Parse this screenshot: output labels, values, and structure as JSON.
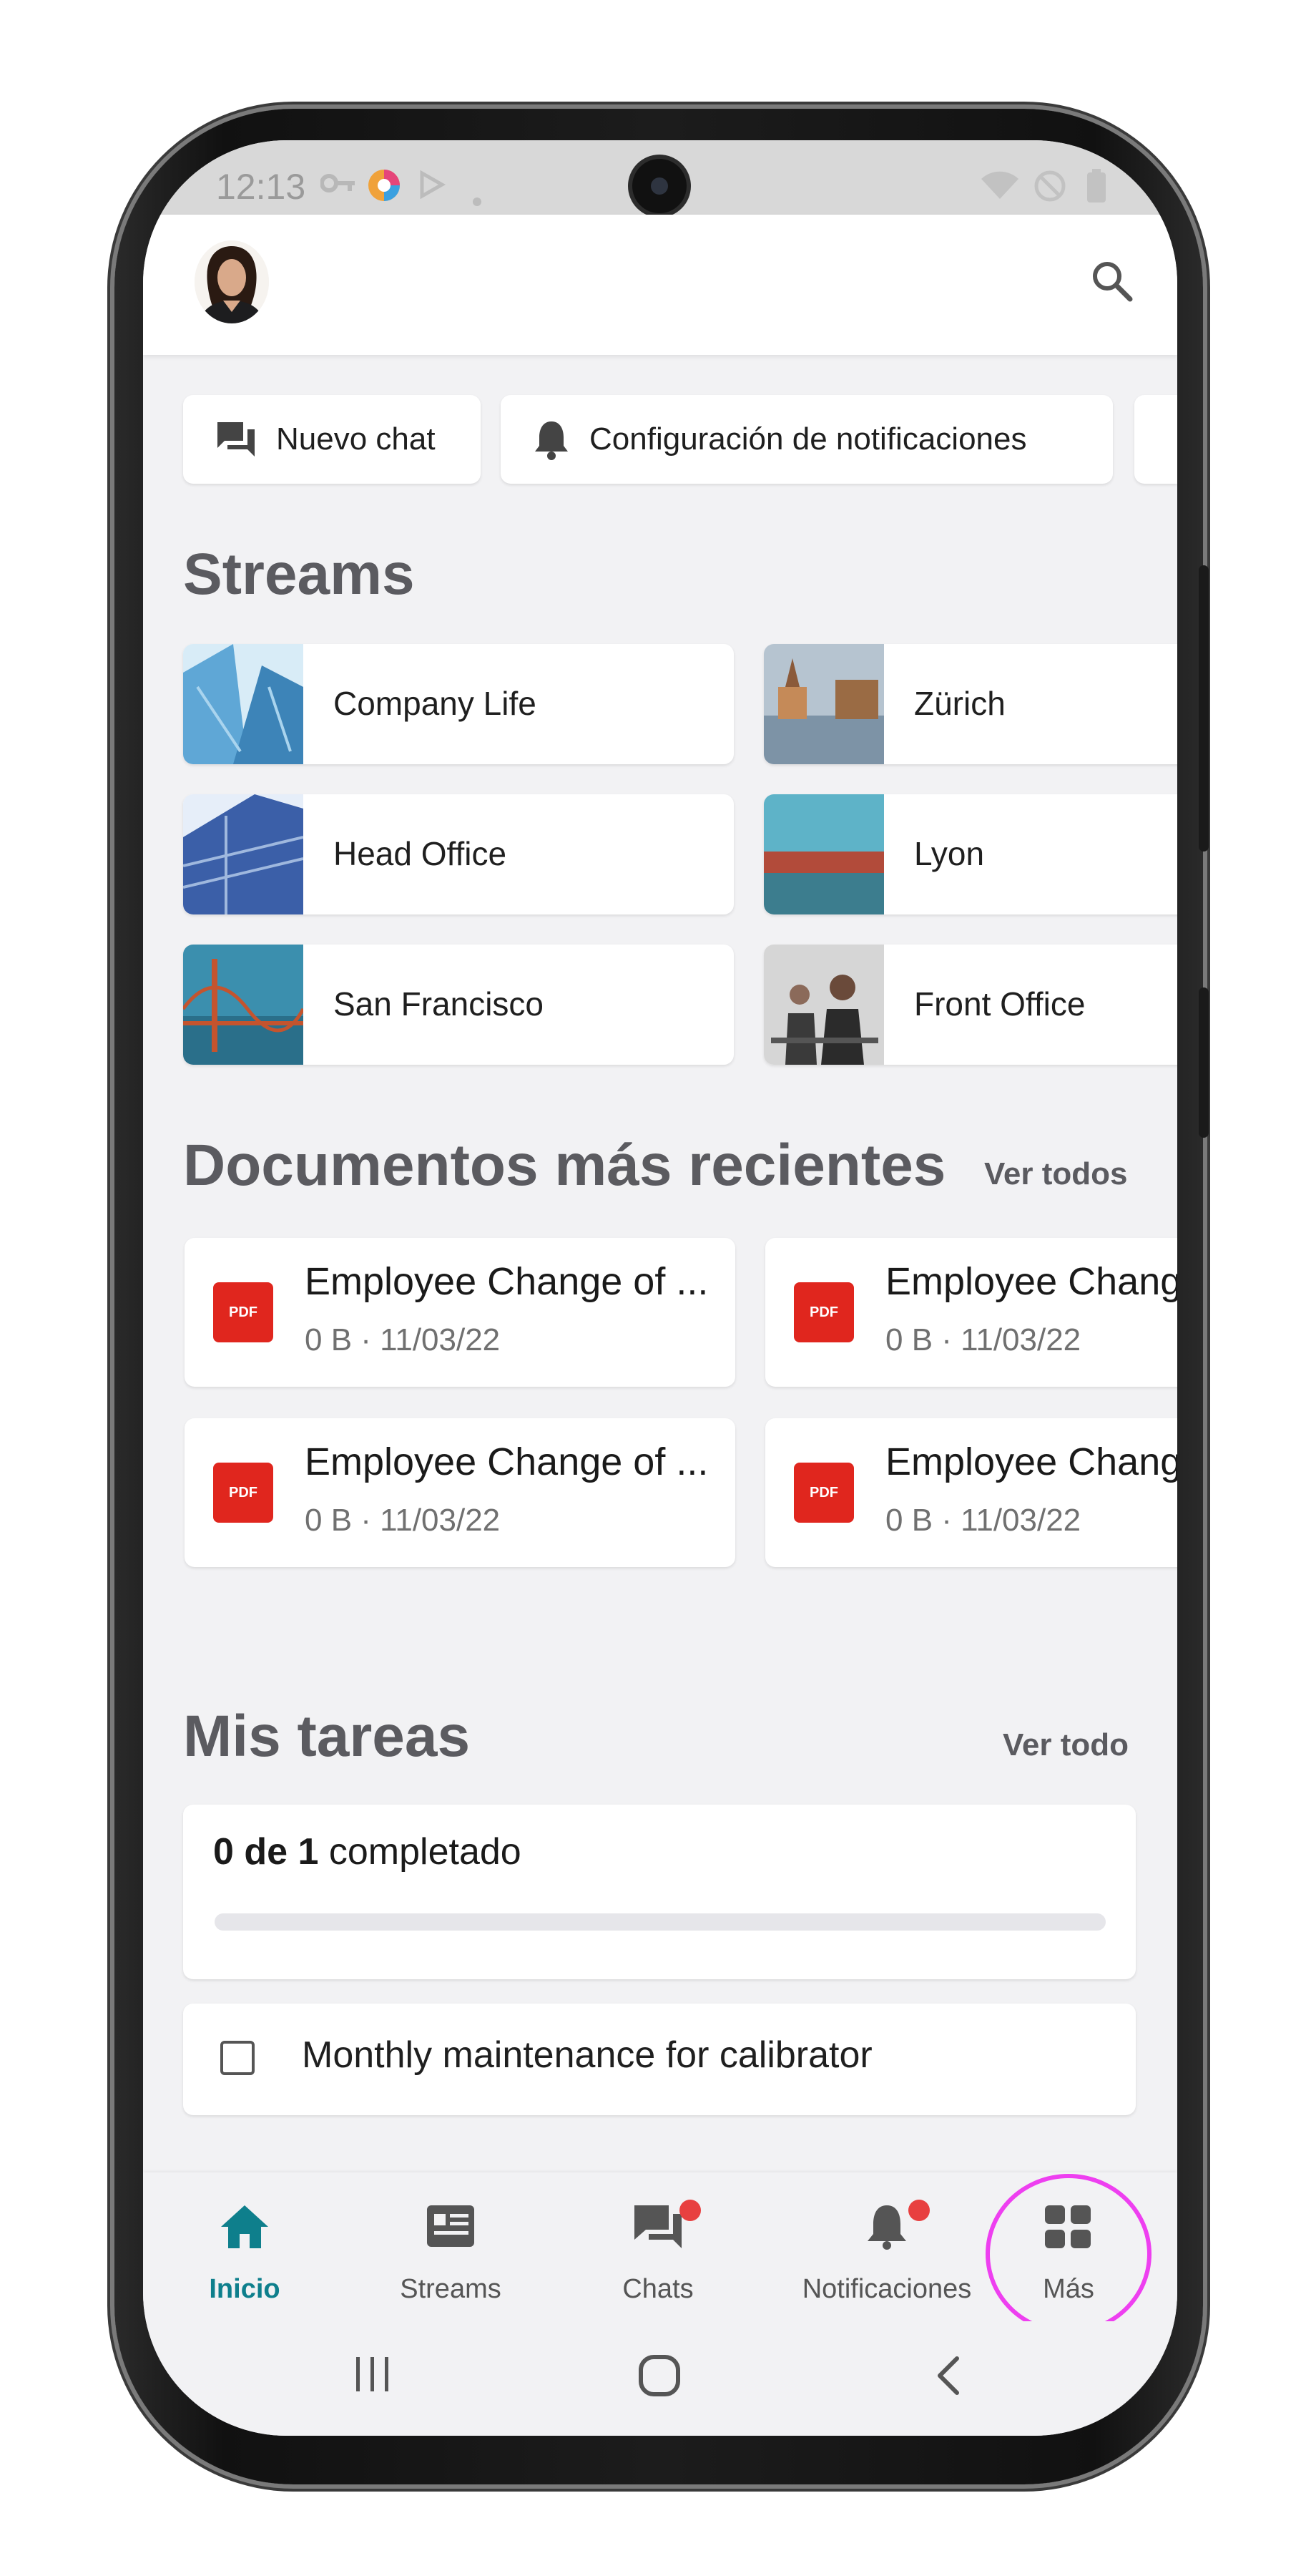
{
  "status_bar": {
    "time": "12:13"
  },
  "quick_actions": [
    {
      "label": "Nuevo chat",
      "icon": "chat-icon"
    },
    {
      "label": "Configuración de notificaciones",
      "icon": "bell-icon"
    }
  ],
  "streams": {
    "title": "Streams",
    "items": [
      {
        "label": "Company Life",
        "thumb_colors": [
          "#5fa7d6",
          "#d8ecf7"
        ]
      },
      {
        "label": "Zürich",
        "thumb_colors": [
          "#8aa0b5",
          "#c58a58"
        ]
      },
      {
        "label": "Head Office",
        "thumb_colors": [
          "#3b5fa8",
          "#e6eef9"
        ]
      },
      {
        "label": "Lyon",
        "thumb_colors": [
          "#5eb3c8",
          "#b24b3a"
        ]
      },
      {
        "label": "San Francisco",
        "thumb_colors": [
          "#3b8fae",
          "#c4542e"
        ]
      },
      {
        "label": "Front Office",
        "thumb_colors": [
          "#c7c7c7",
          "#3a3a3a"
        ]
      }
    ]
  },
  "documents": {
    "title": "Documentos más recientes",
    "see_all": "Ver todos",
    "items": [
      {
        "badge": "PDF",
        "title": "Employee Change of ...",
        "meta": "0 B · 11/03/22"
      },
      {
        "badge": "PDF",
        "title": "Employee Chang",
        "meta": "0 B · 11/03/22"
      },
      {
        "badge": "PDF",
        "title": "Employee Change of ...",
        "meta": "0 B · 11/03/22"
      },
      {
        "badge": "PDF",
        "title": "Employee Chang",
        "meta": "0 B · 11/03/22"
      }
    ]
  },
  "tasks": {
    "title": "Mis tareas",
    "see_all": "Ver todo",
    "summary_bold": "0 de 1",
    "summary_text": "completado",
    "progress": 0,
    "items": [
      {
        "label": "Monthly maintenance for calibrator",
        "checked": false
      }
    ]
  },
  "bottom_nav": [
    {
      "label": "Inicio",
      "icon": "home-icon",
      "active": true
    },
    {
      "label": "Streams",
      "icon": "streams-icon",
      "active": false
    },
    {
      "label": "Chats",
      "icon": "chats-icon",
      "active": false,
      "badge": true
    },
    {
      "label": "Notificaciones",
      "icon": "bell-icon",
      "active": false,
      "badge": true
    },
    {
      "label": "Más",
      "icon": "grid-icon",
      "active": false
    }
  ],
  "colors": {
    "accent": "#0e7f8c",
    "badge": "#e84040",
    "pdf": "#e0261e",
    "highlight": "#ee3ff0",
    "background": "#f2f2f4"
  }
}
